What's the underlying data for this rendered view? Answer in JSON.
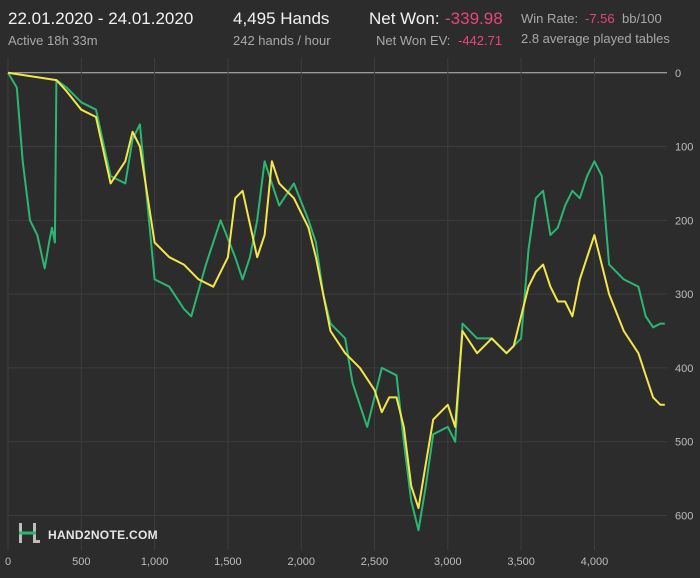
{
  "header": {
    "date_range": "22.01.2020 - 24.01.2020",
    "active": "Active 18h 33m",
    "hands": "4,495 Hands",
    "hands_per_hour": "242 hands / hour",
    "net_won_label": "Net Won:",
    "net_won_value": "-339.98",
    "net_won_ev_label": "Net Won  EV:",
    "net_won_ev_value": "-442.71",
    "win_rate_label": "Win Rate:",
    "win_rate_value": "-7.56",
    "win_rate_unit": "bb/100",
    "avg_tables": "2.8 average played tables"
  },
  "logo": {
    "text": "HAND2NOTE.COM"
  },
  "colors": {
    "net_won": "#2bb673",
    "ev": "#f4e64a",
    "negative": "#e8457a"
  },
  "chart_data": {
    "type": "line",
    "x_axis": {
      "ticks": [
        0,
        500,
        1000,
        1500,
        2000,
        2500,
        3000,
        3500,
        4000
      ],
      "tick_labels": [
        "0",
        "500",
        "1,000",
        "1,500",
        "2,000",
        "2,500",
        "3,000",
        "3,500",
        "4,000"
      ],
      "range": [
        0,
        4495
      ]
    },
    "y_axis": {
      "ticks": [
        0,
        100,
        200,
        300,
        400,
        500,
        600
      ],
      "tick_labels": [
        "0",
        "100",
        "200",
        "300",
        "400",
        "500",
        "600"
      ],
      "inverted": true,
      "range": [
        -20,
        640
      ],
      "position": "right"
    },
    "grid": true,
    "series": [
      {
        "color": "#2bb673",
        "points": [
          [
            0,
            0
          ],
          [
            60,
            20
          ],
          [
            100,
            120
          ],
          [
            150,
            200
          ],
          [
            200,
            220
          ],
          [
            250,
            265
          ],
          [
            280,
            230
          ],
          [
            300,
            210
          ],
          [
            320,
            230
          ],
          [
            330,
            10
          ],
          [
            400,
            20
          ],
          [
            500,
            40
          ],
          [
            600,
            50
          ],
          [
            700,
            140
          ],
          [
            800,
            150
          ],
          [
            850,
            90
          ],
          [
            900,
            70
          ],
          [
            1000,
            280
          ],
          [
            1100,
            290
          ],
          [
            1200,
            320
          ],
          [
            1250,
            330
          ],
          [
            1350,
            260
          ],
          [
            1450,
            200
          ],
          [
            1550,
            250
          ],
          [
            1600,
            280
          ],
          [
            1650,
            250
          ],
          [
            1700,
            200
          ],
          [
            1750,
            120
          ],
          [
            1800,
            150
          ],
          [
            1850,
            180
          ],
          [
            1950,
            150
          ],
          [
            2050,
            200
          ],
          [
            2100,
            230
          ],
          [
            2150,
            300
          ],
          [
            2200,
            340
          ],
          [
            2300,
            360
          ],
          [
            2350,
            420
          ],
          [
            2450,
            480
          ],
          [
            2550,
            400
          ],
          [
            2650,
            410
          ],
          [
            2700,
            500
          ],
          [
            2750,
            580
          ],
          [
            2800,
            620
          ],
          [
            2850,
            560
          ],
          [
            2900,
            490
          ],
          [
            3000,
            480
          ],
          [
            3050,
            500
          ],
          [
            3100,
            340
          ],
          [
            3200,
            360
          ],
          [
            3300,
            360
          ],
          [
            3400,
            380
          ],
          [
            3500,
            360
          ],
          [
            3550,
            240
          ],
          [
            3600,
            170
          ],
          [
            3650,
            160
          ],
          [
            3700,
            220
          ],
          [
            3750,
            210
          ],
          [
            3800,
            180
          ],
          [
            3850,
            160
          ],
          [
            3900,
            170
          ],
          [
            3950,
            140
          ],
          [
            4000,
            120
          ],
          [
            4050,
            140
          ],
          [
            4100,
            260
          ],
          [
            4200,
            280
          ],
          [
            4300,
            290
          ],
          [
            4350,
            330
          ],
          [
            4400,
            345
          ],
          [
            4450,
            340
          ],
          [
            4480,
            340
          ]
        ]
      },
      {
        "color": "#f4e64a",
        "points": [
          [
            0,
            0
          ],
          [
            330,
            10
          ],
          [
            400,
            25
          ],
          [
            500,
            50
          ],
          [
            600,
            60
          ],
          [
            700,
            150
          ],
          [
            800,
            120
          ],
          [
            850,
            80
          ],
          [
            900,
            100
          ],
          [
            1000,
            230
          ],
          [
            1100,
            250
          ],
          [
            1200,
            260
          ],
          [
            1300,
            280
          ],
          [
            1400,
            290
          ],
          [
            1500,
            250
          ],
          [
            1550,
            170
          ],
          [
            1600,
            160
          ],
          [
            1700,
            250
          ],
          [
            1750,
            220
          ],
          [
            1800,
            120
          ],
          [
            1850,
            150
          ],
          [
            1950,
            170
          ],
          [
            2050,
            210
          ],
          [
            2100,
            250
          ],
          [
            2150,
            300
          ],
          [
            2200,
            350
          ],
          [
            2300,
            380
          ],
          [
            2400,
            400
          ],
          [
            2500,
            430
          ],
          [
            2550,
            460
          ],
          [
            2600,
            440
          ],
          [
            2650,
            440
          ],
          [
            2700,
            480
          ],
          [
            2750,
            560
          ],
          [
            2800,
            590
          ],
          [
            2850,
            530
          ],
          [
            2900,
            470
          ],
          [
            3000,
            450
          ],
          [
            3050,
            480
          ],
          [
            3100,
            350
          ],
          [
            3200,
            380
          ],
          [
            3300,
            360
          ],
          [
            3400,
            380
          ],
          [
            3450,
            370
          ],
          [
            3500,
            330
          ],
          [
            3550,
            290
          ],
          [
            3600,
            270
          ],
          [
            3650,
            260
          ],
          [
            3700,
            290
          ],
          [
            3750,
            310
          ],
          [
            3800,
            310
          ],
          [
            3850,
            330
          ],
          [
            3900,
            280
          ],
          [
            3950,
            250
          ],
          [
            4000,
            220
          ],
          [
            4050,
            260
          ],
          [
            4100,
            300
          ],
          [
            4200,
            350
          ],
          [
            4300,
            380
          ],
          [
            4350,
            410
          ],
          [
            4400,
            440
          ],
          [
            4450,
            450
          ],
          [
            4480,
            450
          ]
        ]
      }
    ]
  }
}
